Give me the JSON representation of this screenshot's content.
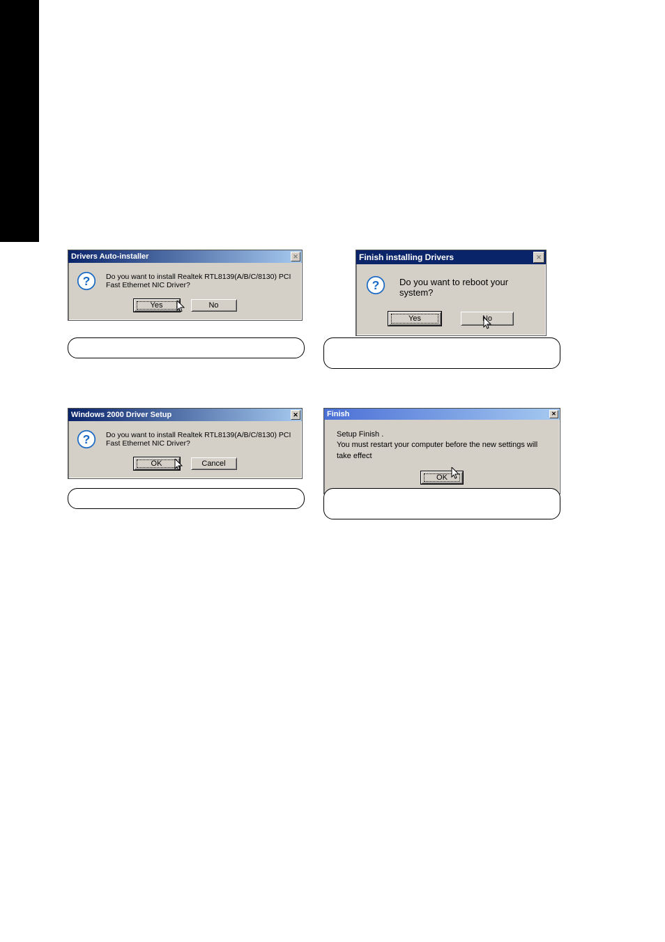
{
  "dialog1": {
    "title": "Drivers Auto-installer",
    "message": "Do you want to install Realtek RTL8139(A/B/C/8130) PCI Fast Ethernet NIC Driver?",
    "yes": "Yes",
    "no": "No"
  },
  "dialog2": {
    "title": "Finish installing Drivers",
    "message": "Do you want to reboot your system?",
    "yes": "Yes",
    "no": "No"
  },
  "dialog3": {
    "title": "Windows 2000 Driver Setup",
    "message": "Do you want to install Realtek RTL8139(A/B/C/8130) PCI Fast Ethernet NIC Driver?",
    "ok": "OK",
    "cancel": "Cancel"
  },
  "dialog4": {
    "title": "Finish",
    "line1": "Setup Finish .",
    "line2": "You must restart your computer before the new settings will take effect",
    "ok": "OK"
  }
}
